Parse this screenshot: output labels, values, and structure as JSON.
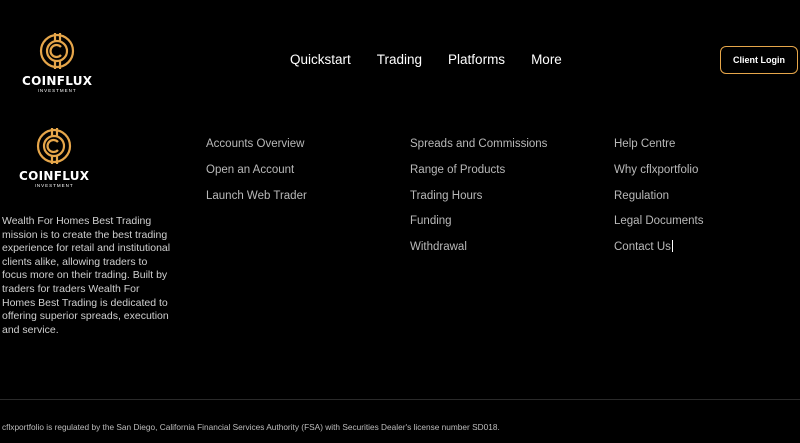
{
  "brand": {
    "name": "COINFLUX",
    "tagline": "INVESTMENT",
    "accent": "#e6a64a"
  },
  "nav": {
    "items": [
      "Quickstart",
      "Trading",
      "Platforms",
      "More"
    ]
  },
  "header": {
    "client_login_label": "Client Login"
  },
  "footer": {
    "columns": [
      [
        "Accounts Overview",
        "Open an Account",
        "Launch Web Trader"
      ],
      [
        "Spreads and Commissions",
        "Range of Products",
        "Trading Hours",
        "Funding",
        "Withdrawal"
      ],
      [
        "Help Centre",
        "Why cflxportfolio",
        "Regulation",
        "Legal Documents",
        "Contact Us"
      ]
    ],
    "mission": "Wealth For Homes Best Trading mission is to create the best trading experience for retail and institutional clients alike, allowing traders to focus more on their trading. Built by traders for traders Wealth For Homes Best Trading is dedicated to offering superior spreads, execution and service.",
    "legal": "cflxportfolio is regulated by the San Diego, California Financial Services Authority (FSA) with Securities Dealer's license number SD018."
  }
}
